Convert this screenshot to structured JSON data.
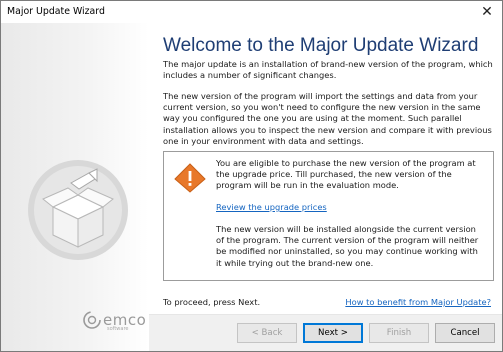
{
  "window": {
    "title": "Major Update Wizard",
    "close_glyph": "✕"
  },
  "heading": "Welcome to the Major Update Wizard",
  "paragraphs": {
    "intro": "The major update is an installation of brand-new version of the program, which includes a number of significant changes.",
    "details": "The new version of the program will import the settings and data from your current version, so you won't need to configure the new version in the same way you configured the one you are using at the moment. Such parallel installation allows you to inspect the new version and compare it with previous one in your environment with data and settings."
  },
  "notice": {
    "icon": "warning-icon",
    "text1": "You are eligible to purchase the new version of the program at the upgrade price. Till purchased, the new version of the program will be run in the evaluation mode.",
    "link": "Review the upgrade prices",
    "text2": "The new version will be installed alongside the current version of the program. The current version of the program will neither be modified nor uninstalled, so you may continue working with it while trying out the brand-new one."
  },
  "footer": {
    "proceed": "To proceed, press Next.",
    "benefit_link": "How to benefit from Major Update?"
  },
  "buttons": {
    "back": "< Back",
    "next": "Next >",
    "finish": "Finish",
    "cancel": "Cancel"
  },
  "branding": {
    "name": "emco",
    "sub": "software"
  },
  "colors": {
    "heading": "#1f3e74",
    "link": "#1565c0",
    "warning": "#e8782a"
  }
}
